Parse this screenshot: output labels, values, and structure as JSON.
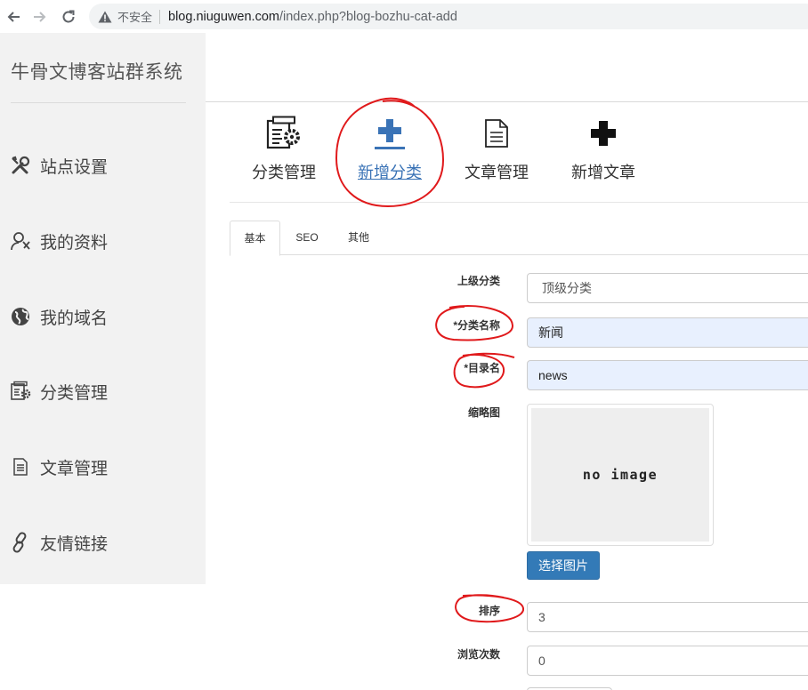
{
  "browser": {
    "insecure_label": "不安全",
    "url_host": "blog.niuguwen.com",
    "url_path": "/index.php?blog-bozhu-cat-add"
  },
  "sidebar": {
    "brand": "牛骨文博客站群系统",
    "items": [
      {
        "label": "站点设置",
        "icon": "tools-icon"
      },
      {
        "label": "我的资料",
        "icon": "user-icon"
      },
      {
        "label": "我的域名",
        "icon": "globe-icon"
      },
      {
        "label": "分类管理",
        "icon": "category-settings-icon"
      },
      {
        "label": "文章管理",
        "icon": "document-icon"
      },
      {
        "label": "友情链接",
        "icon": "link-icon"
      }
    ]
  },
  "toolbar": {
    "items": [
      {
        "label": "分类管理",
        "icon": "category-settings-icon"
      },
      {
        "label": "新增分类",
        "icon": "add-underline-icon"
      },
      {
        "label": "文章管理",
        "icon": "document-icon"
      },
      {
        "label": "新增文章",
        "icon": "plus-icon"
      }
    ]
  },
  "tabs": [
    {
      "label": "基本"
    },
    {
      "label": "SEO"
    },
    {
      "label": "其他"
    }
  ],
  "form": {
    "parent_label": "上级分类",
    "parent_value": "顶级分类",
    "name_label": "*分类名称",
    "name_value": "新闻",
    "dir_label": "*目录名",
    "dir_value": "news",
    "thumb_label": "缩略图",
    "thumb_placeholder": "no image",
    "pick_button": "选择图片",
    "sort_label": "排序",
    "sort_value": "3",
    "views_label": "浏览次数",
    "views_value": "0"
  },
  "colors": {
    "accent": "#337ab7",
    "annotation": "#e0191b",
    "sidebar_bg": "#f2f2f2"
  }
}
